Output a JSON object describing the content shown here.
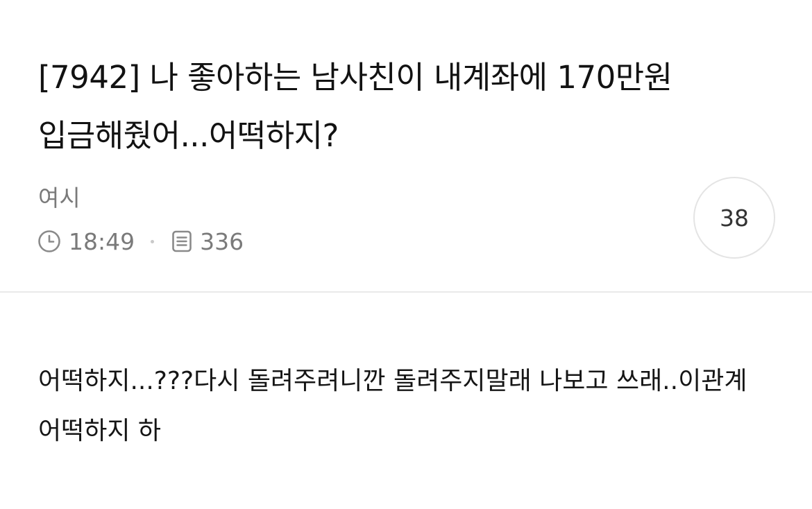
{
  "post": {
    "title": "[7942] 나 좋아하는 남사친이 내계좌에 170만원 입금해줬어...어떡하지?",
    "author": "여시",
    "time": "18:49",
    "views": "336",
    "comment_count": "38",
    "body": "어떡하지...???다시 돌려주려니깐 돌려주지말래 나보고 쓰래..이관계 어떡하지 하"
  },
  "icons": {
    "time": "clock-icon",
    "views": "document-icon"
  },
  "colors": {
    "text": "#121212",
    "meta": "#7a7a7a",
    "divider": "#e9e9e9",
    "badge_border": "#e4e4e4"
  }
}
